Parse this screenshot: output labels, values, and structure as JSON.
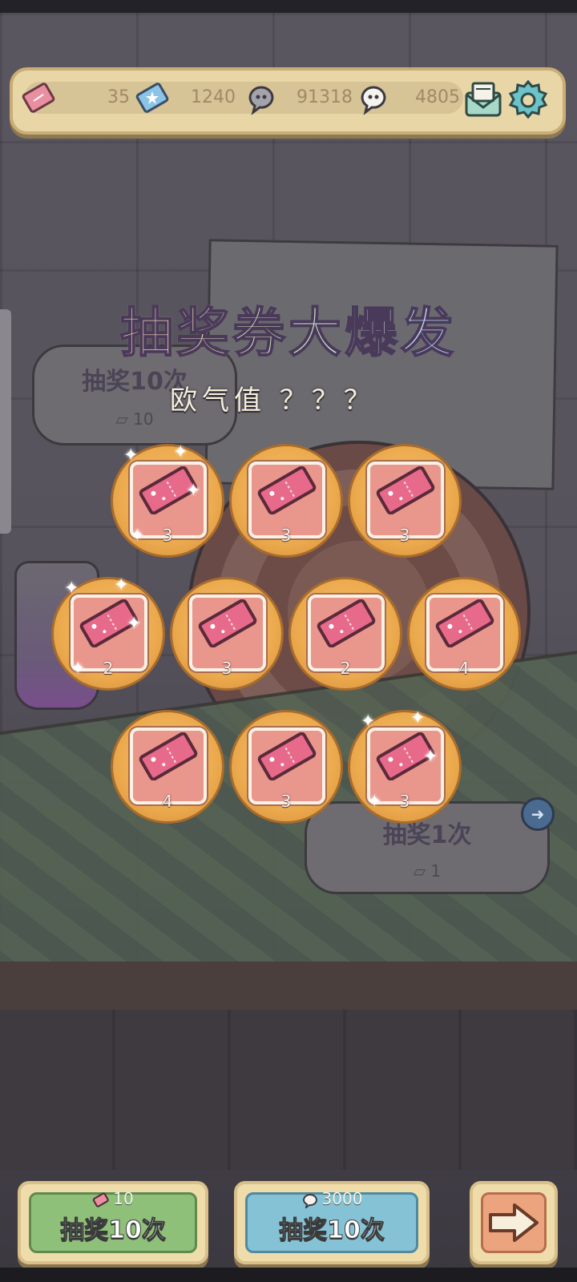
{
  "resources": [
    {
      "icon": "pink-ticket-icon",
      "value": "35"
    },
    {
      "icon": "blue-ticket-icon",
      "value": "1240"
    },
    {
      "icon": "gray-ghost-icon",
      "value": "91318"
    },
    {
      "icon": "white-ghost-icon",
      "value": "4805"
    }
  ],
  "topbar_buttons": {
    "mail": "mail-icon",
    "settings": "gear-icon"
  },
  "headline": "抽奖券大爆发",
  "luck_text": "欧气值 ？？？",
  "background": {
    "bubble_left_title": "抽奖10次",
    "bubble_left_cost": "10",
    "bubble_right_title": "抽奖1次",
    "bubble_right_cost": "1"
  },
  "rewards": [
    {
      "count": "3"
    },
    {
      "count": "3"
    },
    {
      "count": "3"
    },
    {
      "count": "2"
    },
    {
      "count": "3"
    },
    {
      "count": "2"
    },
    {
      "count": "4"
    },
    {
      "count": "4"
    },
    {
      "count": "3"
    },
    {
      "count": "3"
    }
  ],
  "buttons": {
    "draw10_ticket": {
      "cost": "10",
      "label": "抽奖10次",
      "cost_icon": "pink-ticket-icon"
    },
    "draw10_ghost": {
      "cost": "3000",
      "label": "抽奖10次",
      "cost_icon": "ghost-icon"
    },
    "next": {
      "icon": "right-arrow-icon"
    }
  },
  "colors": {
    "reward_disc": "#ecaa4e",
    "reward_tile": "#e9978c",
    "green_button": "#8fc07a",
    "blue_button": "#86c2d6",
    "orange_button": "#eba47e",
    "topbar": "#e8d6a6"
  }
}
